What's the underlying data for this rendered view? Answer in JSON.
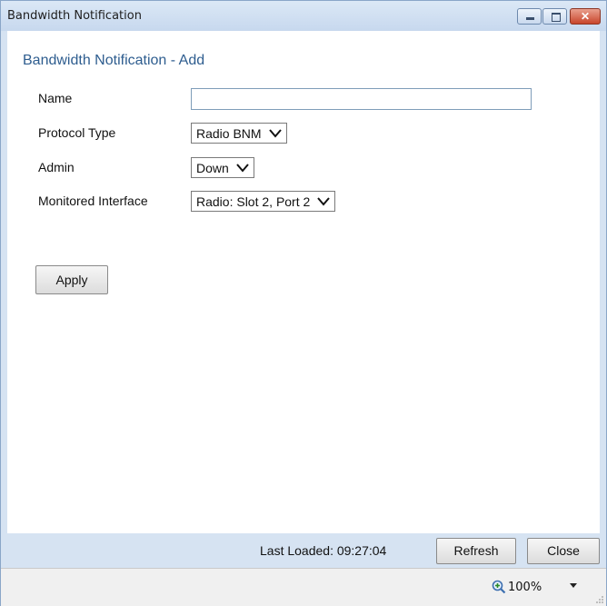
{
  "window": {
    "title": "Bandwidth Notification",
    "controls": [
      "minimize-icon",
      "restore-icon",
      "close-icon"
    ],
    "close_glyph": "✕",
    "accent_close": "#c8452b"
  },
  "form": {
    "heading": "Bandwidth Notification - Add",
    "fields": {
      "name": {
        "label": "Name",
        "value": ""
      },
      "protocol_type": {
        "label": "Protocol Type",
        "value": "Radio BNM"
      },
      "admin": {
        "label": "Admin",
        "value": "Down"
      },
      "monitored_interface": {
        "label": "Monitored Interface",
        "value": "Radio: Slot 2, Port 2"
      }
    },
    "apply_label": "Apply"
  },
  "footer": {
    "last_loaded": "Last Loaded: 09:27:04",
    "refresh_label": "Refresh",
    "close_label": "Close"
  },
  "statusbar": {
    "zoom": "100%",
    "zoom_icon": "zoom-in-icon"
  },
  "colors": {
    "heading": "#2e5d8f",
    "frame": "#d6e3f2"
  }
}
